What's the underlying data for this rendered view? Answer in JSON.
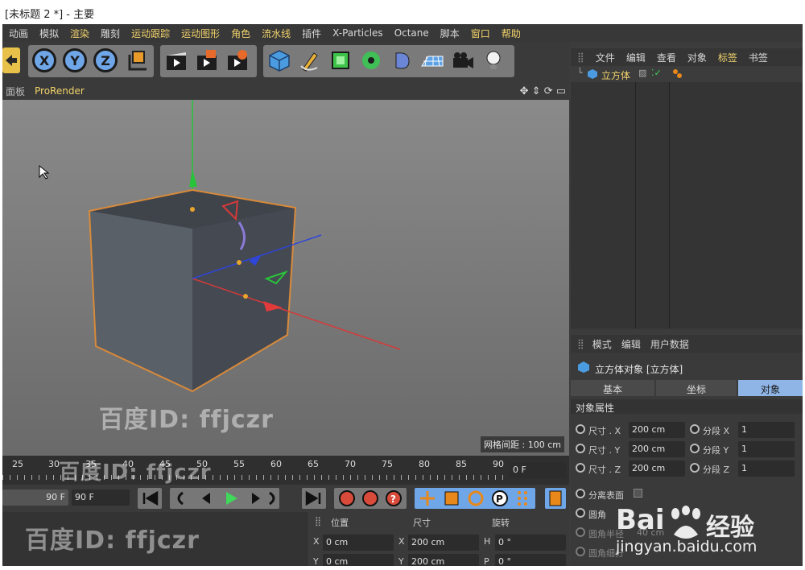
{
  "window": {
    "title": "[未标题 2 *] - 主要"
  },
  "menubar": [
    "动画",
    "模拟",
    "渲染",
    "雕刻",
    "运动跟踪",
    "运动图形",
    "角色",
    "流水线",
    "插件",
    "X-Particles",
    "Octane",
    "脚本",
    "窗口",
    "帮助"
  ],
  "toolbar": {
    "axes": [
      "X",
      "Y",
      "Z"
    ]
  },
  "viewport": {
    "tabs": [
      "面板",
      "ProRender"
    ],
    "grid_spacing": "网格间距 : 100 cm"
  },
  "timeline": {
    "ticks": [
      "25",
      "30",
      "35",
      "40",
      "45",
      "50",
      "55",
      "60",
      "65",
      "70",
      "75",
      "80",
      "85",
      "90"
    ],
    "current_frame": "0 F",
    "end_frame_a": "90 F",
    "end_frame_b": "90 F"
  },
  "object_manager": {
    "menu": [
      "文件",
      "编辑",
      "查看",
      "对象",
      "标签",
      "书签"
    ],
    "objects": [
      {
        "name": "立方体"
      }
    ]
  },
  "attribute_manager": {
    "menu": [
      "模式",
      "编辑",
      "用户数据"
    ],
    "object_title": "立方体对象 [立方体]",
    "tabs": [
      "基本",
      "坐标",
      "对象"
    ],
    "section": "对象属性",
    "size_rows": [
      {
        "label": "尺寸 . X",
        "value": "200 cm",
        "seg_label": "分段 X",
        "seg_value": "1"
      },
      {
        "label": "尺寸 . Y",
        "value": "200 cm",
        "seg_label": "分段 Y",
        "seg_value": "1"
      },
      {
        "label": "尺寸 . Z",
        "value": "200 cm",
        "seg_label": "分段 Z",
        "seg_value": "1"
      }
    ],
    "separate_surfaces": "分离表面",
    "fillet": "圆角",
    "fillet_radius": "圆角半径",
    "fillet_radius_value": "40 cm",
    "fillet_subdiv": "圆角细分"
  },
  "coord_panel": {
    "headers": [
      "位置",
      "尺寸",
      "旋转"
    ],
    "rows": [
      {
        "a": "X",
        "av": "0 cm",
        "b": "X",
        "bv": "200 cm",
        "c": "H",
        "cv": "0 °"
      },
      {
        "a": "Y",
        "av": "0 cm",
        "b": "Y",
        "bv": "200 cm",
        "c": "P",
        "cv": "0 °"
      }
    ]
  },
  "watermarks": {
    "main": "百度ID: ffjczr",
    "baidu": "Bai",
    "jingyan": "经验",
    "url": "jingyan.baidu.com"
  },
  "colors": {
    "accent": "#f2d36b",
    "axis_x": "#d63a3a",
    "axis_y": "#29c33a",
    "axis_z": "#2f46d8",
    "cube_edge": "#d88a3a",
    "tab_active": "#8fb5e6"
  }
}
